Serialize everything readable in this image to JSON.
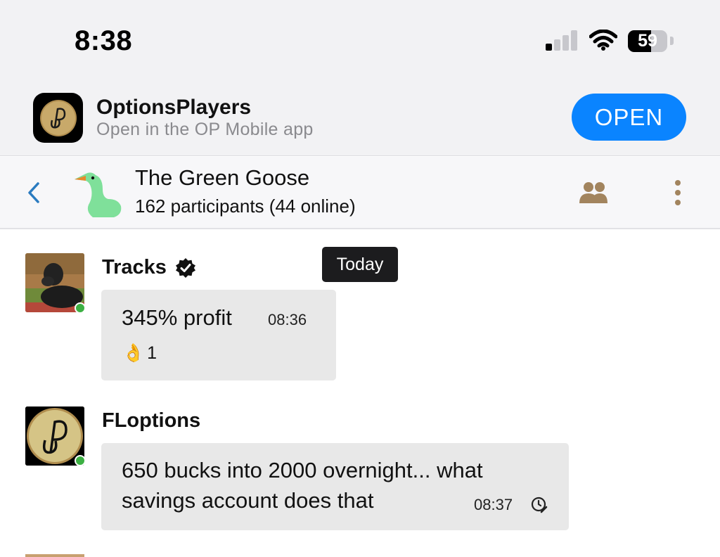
{
  "status_bar": {
    "time": "8:38",
    "battery_percent": "59",
    "battery_level": 0.59,
    "signal_bars": 1
  },
  "app_banner": {
    "app_name": "OptionsPlayers",
    "subtitle": "Open in the OP Mobile app",
    "open_label": "OPEN",
    "accent_color": "#0a84ff"
  },
  "chat_header": {
    "title": "The Green Goose",
    "subtitle": "162 participants (44 online)",
    "icons": [
      "chevron-left-icon",
      "goose-icon",
      "group-icon",
      "more-vertical-icon"
    ],
    "icon_color": "#a2845e"
  },
  "date_chip": "Today",
  "messages": [
    {
      "sender": "Tracks",
      "verified": true,
      "online": true,
      "text": "345% profit",
      "time": "08:36",
      "reaction": {
        "emoji": "👌",
        "count": "1"
      }
    },
    {
      "sender": "FLoptions",
      "verified": false,
      "online": true,
      "text_lines": [
        "650 bucks into 2000 overnight... what",
        "savings account does that"
      ],
      "time": "08:37",
      "status_icon": "clock-pending-icon"
    }
  ]
}
